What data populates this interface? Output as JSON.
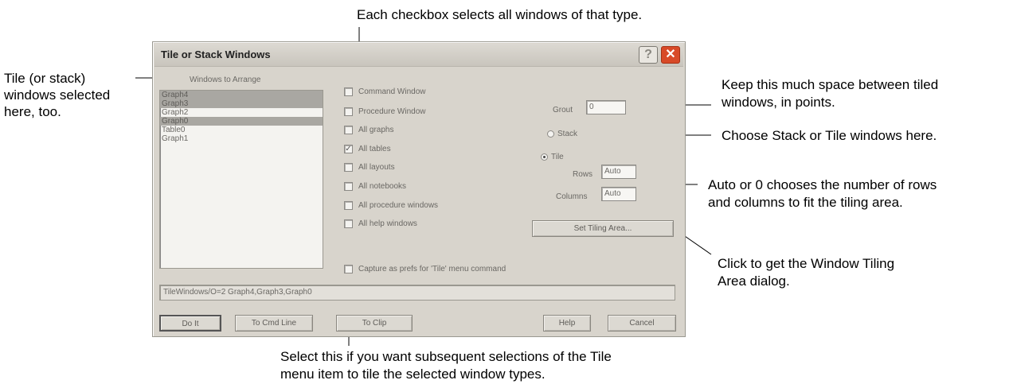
{
  "dialog": {
    "title": "Tile or Stack Windows",
    "windows_to_arrange_label": "Windows to Arrange",
    "window_list": [
      {
        "name": "Graph4",
        "selected": true
      },
      {
        "name": "Graph3",
        "selected": true
      },
      {
        "name": "Graph2",
        "selected": false
      },
      {
        "name": "Graph0",
        "selected": true
      },
      {
        "name": "Table0",
        "selected": false
      },
      {
        "name": "Graph1",
        "selected": false
      }
    ],
    "checkboxes": [
      {
        "label": "Command Window",
        "checked": false
      },
      {
        "label": "Procedure Window",
        "checked": false
      },
      {
        "label": "All graphs",
        "checked": false
      },
      {
        "label": "All tables",
        "checked": true
      },
      {
        "label": "All layouts",
        "checked": false
      },
      {
        "label": "All notebooks",
        "checked": false
      },
      {
        "label": "All procedure windows",
        "checked": false
      },
      {
        "label": "All help windows",
        "checked": false
      }
    ],
    "capture_label": "Capture as prefs for 'Tile' menu command",
    "capture_checked": false,
    "grout_label": "Grout",
    "grout_value": "0",
    "stack_label": "Stack",
    "tile_label": "Tile",
    "mode_selected": "Tile",
    "rows_label": "Rows",
    "rows_value": "Auto",
    "columns_label": "Columns",
    "columns_value": "Auto",
    "set_tiling_area_button": "Set Tiling Area...",
    "command_line": "TileWindows/O=2 Graph4,Graph3,Graph0",
    "buttons": {
      "do_it": "Do It",
      "to_cmd_line": "To Cmd Line",
      "to_clip": "To Clip",
      "help": "Help",
      "cancel": "Cancel"
    }
  },
  "callouts": {
    "top": "Each checkbox selects all windows of that type.",
    "left_1": "Tile (or stack)",
    "left_2": "windows selected",
    "left_3": "here, too.",
    "grout_1": "Keep this much space between tiled",
    "grout_2": "windows, in points.",
    "stack": "Choose Stack or Tile windows here.",
    "auto_1": "Auto or 0 chooses the number of rows",
    "auto_2": "and columns to fit the tiling area.",
    "tiling_1": "Click to get the Window Tiling",
    "tiling_2": "Area dialog.",
    "bottom_1": "Select this if you want subsequent selections of the Tile",
    "bottom_2": "menu item to tile the selected window types."
  }
}
